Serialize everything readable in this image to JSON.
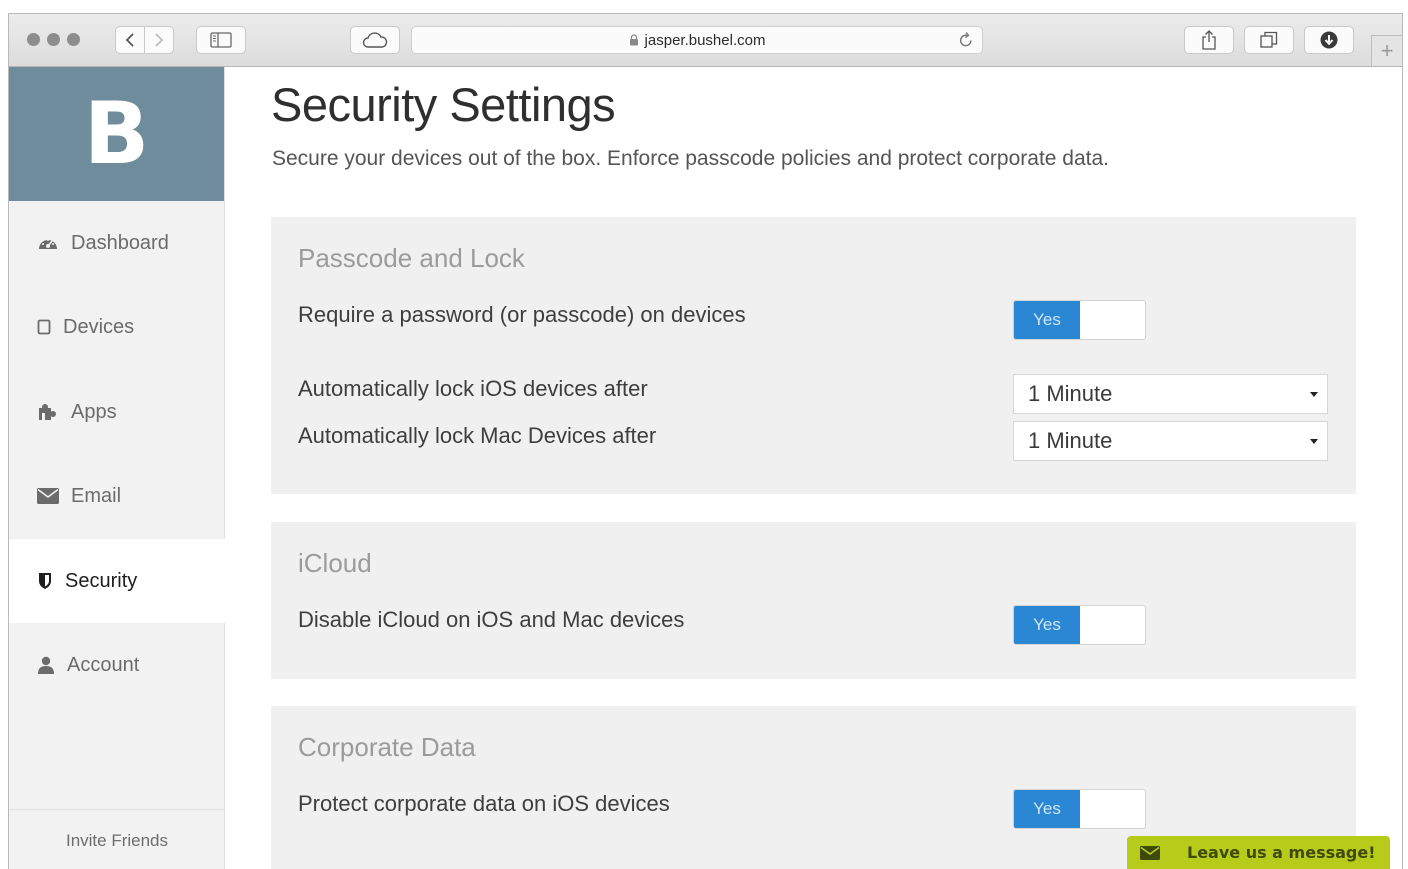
{
  "browser": {
    "url": "jasper.bushel.com",
    "new_tab_label": "+"
  },
  "sidebar": {
    "brand_letter": "B",
    "items": [
      {
        "label": "Dashboard",
        "icon": "dashboard-icon"
      },
      {
        "label": "Devices",
        "icon": "device-icon"
      },
      {
        "label": "Apps",
        "icon": "puzzle-icon"
      },
      {
        "label": "Email",
        "icon": "envelope-icon"
      },
      {
        "label": "Security",
        "icon": "shield-icon",
        "active": true
      },
      {
        "label": "Account",
        "icon": "user-icon"
      }
    ],
    "invite_label": "Invite Friends"
  },
  "page": {
    "title": "Security Settings",
    "subtitle": "Secure your devices out of the box. Enforce passcode policies and protect corporate data."
  },
  "sections": {
    "passcode": {
      "title": "Passcode and Lock",
      "require_password_label": "Require a password (or passcode) on devices",
      "require_password_value": "Yes",
      "ios_lock_label": "Automatically lock iOS devices after",
      "ios_lock_value": "1 Minute",
      "mac_lock_label": "Automatically lock Mac Devices after",
      "mac_lock_value": "1 Minute"
    },
    "icloud": {
      "title": "iCloud",
      "disable_label": "Disable iCloud on iOS and Mac devices",
      "disable_value": "Yes"
    },
    "corporate": {
      "title": "Corporate Data",
      "protect_label": "Protect corporate data on iOS devices",
      "protect_value": "Yes"
    }
  },
  "chat_widget": {
    "label": "Leave us a message!"
  },
  "colors": {
    "brand_bg": "#6f8c9c",
    "toggle_on": "#2a87d3",
    "chat_bg": "#b7cc1a"
  }
}
